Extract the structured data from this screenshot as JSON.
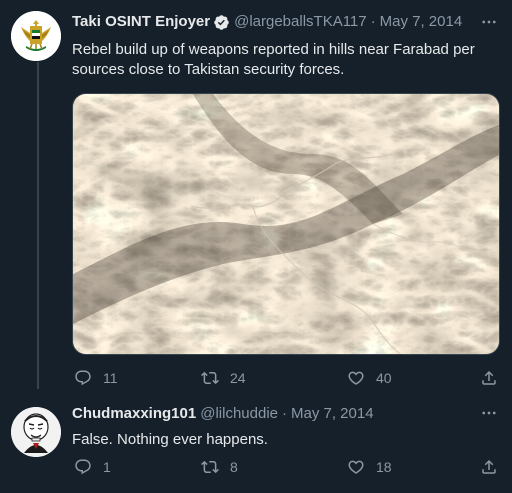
{
  "tweets": [
    {
      "author_name": "Taki OSINT Enjoyer",
      "verified": true,
      "handle": "@largeballsTKA117",
      "separator": "·",
      "date": "May 7, 2014",
      "text": "Rebel build up of weapons reported in hills near Farabad per sources close to Takistan security forces.",
      "has_media": true,
      "replies": "11",
      "retweets": "24",
      "likes": "40"
    },
    {
      "author_name": "Chudmaxxing101",
      "handle": "@lilchuddie",
      "separator": "·",
      "date": "May 7, 2014",
      "text": "False. Nothing ever happens.",
      "replies": "1",
      "retweets": "8",
      "likes": "18"
    }
  ],
  "icons": {
    "verified": "verified-badge-icon",
    "more": "more-options-icon",
    "reply": "reply-icon",
    "retweet": "retweet-icon",
    "like": "like-icon",
    "share": "share-icon"
  },
  "colors": {
    "background": "#15202b",
    "text": "#e7e9ea",
    "muted": "#8b98a5",
    "border": "#38444d"
  }
}
